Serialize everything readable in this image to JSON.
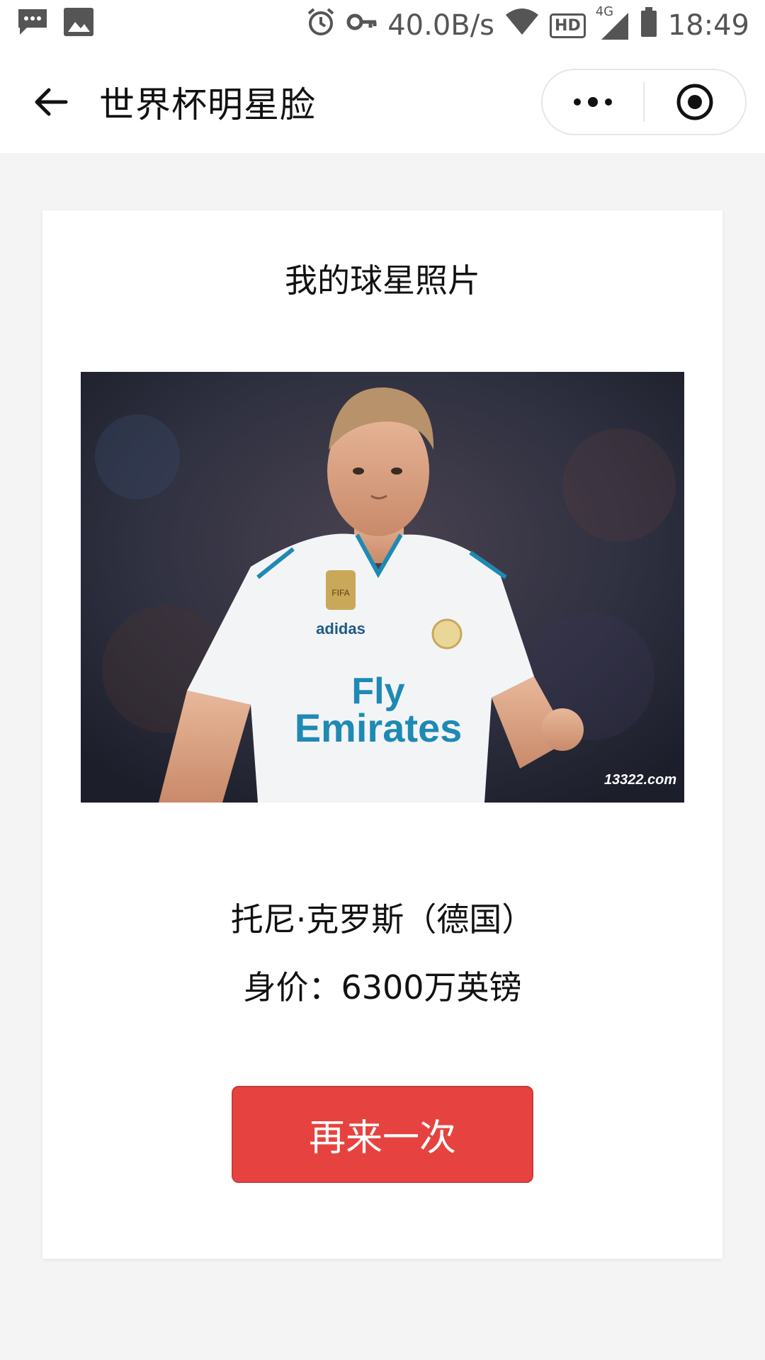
{
  "status_bar": {
    "left_icons": [
      "message-icon",
      "image-icon"
    ],
    "speed": "40.0B/s",
    "network": "4G",
    "hd": "HD",
    "time": "18:49"
  },
  "nav": {
    "title": "世界杯明星脸"
  },
  "card": {
    "title": "我的球星照片",
    "photo_watermark": "13322.com",
    "photo_shirt_text": [
      "Fly",
      "Emirates"
    ],
    "photo_brand": "adidas",
    "photo_badge": "FIFA",
    "player_name": "托尼·克罗斯（德国）",
    "player_price": "身价：6300万英镑",
    "retry_label": "再来一次"
  },
  "colors": {
    "accent_red": "#e64340",
    "background": "#f4f4f4",
    "card": "#ffffff"
  }
}
